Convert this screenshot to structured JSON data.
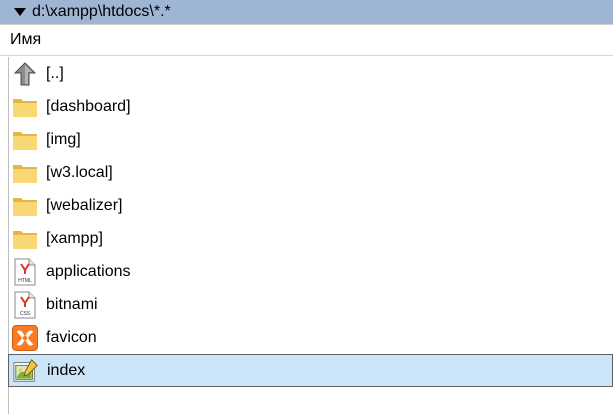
{
  "path_bar": {
    "path": "d:\\xampp\\htdocs\\*.*"
  },
  "column_header": {
    "name_label": "Имя"
  },
  "files": [
    {
      "name": "[..]",
      "icon": "up-arrow-icon",
      "selected": false
    },
    {
      "name": "[dashboard]",
      "icon": "folder-icon",
      "selected": false
    },
    {
      "name": "[img]",
      "icon": "folder-icon",
      "selected": false
    },
    {
      "name": "[w3.local]",
      "icon": "folder-icon",
      "selected": false
    },
    {
      "name": "[webalizer]",
      "icon": "folder-icon",
      "selected": false
    },
    {
      "name": "[xampp]",
      "icon": "folder-icon",
      "selected": false
    },
    {
      "name": "applications",
      "icon": "html-file-icon",
      "icon_text": "HTML",
      "selected": false
    },
    {
      "name": "bitnami",
      "icon": "css-file-icon",
      "icon_text": "CSS",
      "selected": false
    },
    {
      "name": "favicon",
      "icon": "xampp-icon",
      "selected": false
    },
    {
      "name": "index",
      "icon": "php-file-icon",
      "selected": true
    }
  ],
  "colors": {
    "path_bar": "#9fb5d4",
    "selection": "#cce4f7",
    "folder": "#f8d775",
    "brand_orange": "#fb7a24"
  }
}
